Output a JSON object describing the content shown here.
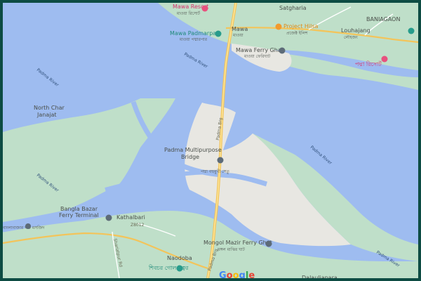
{
  "colors": {
    "water": "#9ebcf0",
    "land": "#bfdfc9",
    "sand": "#e8e7e2",
    "road": "#f7d673",
    "frame": "#0d4c43",
    "pink": "#e8517e",
    "orange": "#f29a2e",
    "teal": "#279c8c",
    "gray_pin": "#5d6b78"
  },
  "places": {
    "mawa_resort": "Mawa Resort",
    "mawa_resort_bn": "মাওয়া রিসোর্ট",
    "satgharia": "Satgharia",
    "baniagaon": "BANIAGAON",
    "louhajang": "Louhajang",
    "louhajang_bn": "লৌহজং",
    "mawa": "Mawa",
    "mawa_bn": "মাওয়া",
    "project_hilsa": "Project Hilsa",
    "project_hilsa_bn": "প্রজেক্ট ইলিশ",
    "mawa_padmarpar": "Mawa Padmarpar",
    "mawa_padmarpar_bn": "মাওয়া পদ্মারপার",
    "mawa_ferry_ghat": "Mawa Ferry Ghat",
    "mawa_ferry_ghat_bn": "মাওয়া ফেরিঘাট",
    "padma_bn_poi": "পদ্মা রিসোর্ট",
    "north_char_janajat": "North Char\nJanajat",
    "padma_multipurpose_bridge": "Padma Multipurpose\nBridge",
    "padma_bridge_bn": "পদ্মা বহুমুখী সেতু",
    "bangla_bazar_ferry_terminal": "Bangla Bazar\nFerry Terminal",
    "kathalbari": "Kathalbari",
    "bangla_bazar_bn": "বাংলাবাজার ঘাট মসজিদ",
    "mongol_mazir_ferry_ghat": "Mongol Mazir Ferry Ghat",
    "mongol_mazir_bn": "মঙ্গল মাঝির ঘাট",
    "naodoba": "Naodoba",
    "goal_chattar_bn": "শিবচর গোল চত্বর",
    "dalauliapara": "Dalauliapara"
  },
  "rivers": {
    "padma_river_1": "Padma River",
    "padma_river_2": "Padma River",
    "padma_river_3": "Padma River",
    "padma_river_4": "Padma River",
    "padma_river_5": "Padma River"
  },
  "roads": {
    "padma_brg": "Padma Brg",
    "padma_brg_south": "Padma Brg",
    "padma_brg_bn": "পদ্মা",
    "z8012": "Z8012",
    "shariatpur_rd": "Shariatpur Rd"
  },
  "attribution": {
    "google": "Google"
  }
}
